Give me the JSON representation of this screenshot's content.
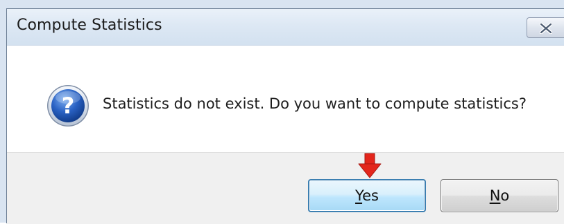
{
  "window": {
    "title": "Compute Statistics",
    "close_icon": "close-x-icon"
  },
  "message": {
    "icon": "question-icon",
    "text": "Statistics do not exist. Do you want to compute statistics?"
  },
  "buttons": {
    "yes": {
      "mnemonic": "Y",
      "rest": "es"
    },
    "no": {
      "mnemonic": "N",
      "rest": "o"
    }
  },
  "annotation": {
    "icon": "red-arrow-down-icon",
    "color": "#e3261c"
  },
  "colors": {
    "title_bar": "#dde8f4",
    "default_button_border": "#3c7fb1",
    "footer": "#f0f0f0"
  }
}
